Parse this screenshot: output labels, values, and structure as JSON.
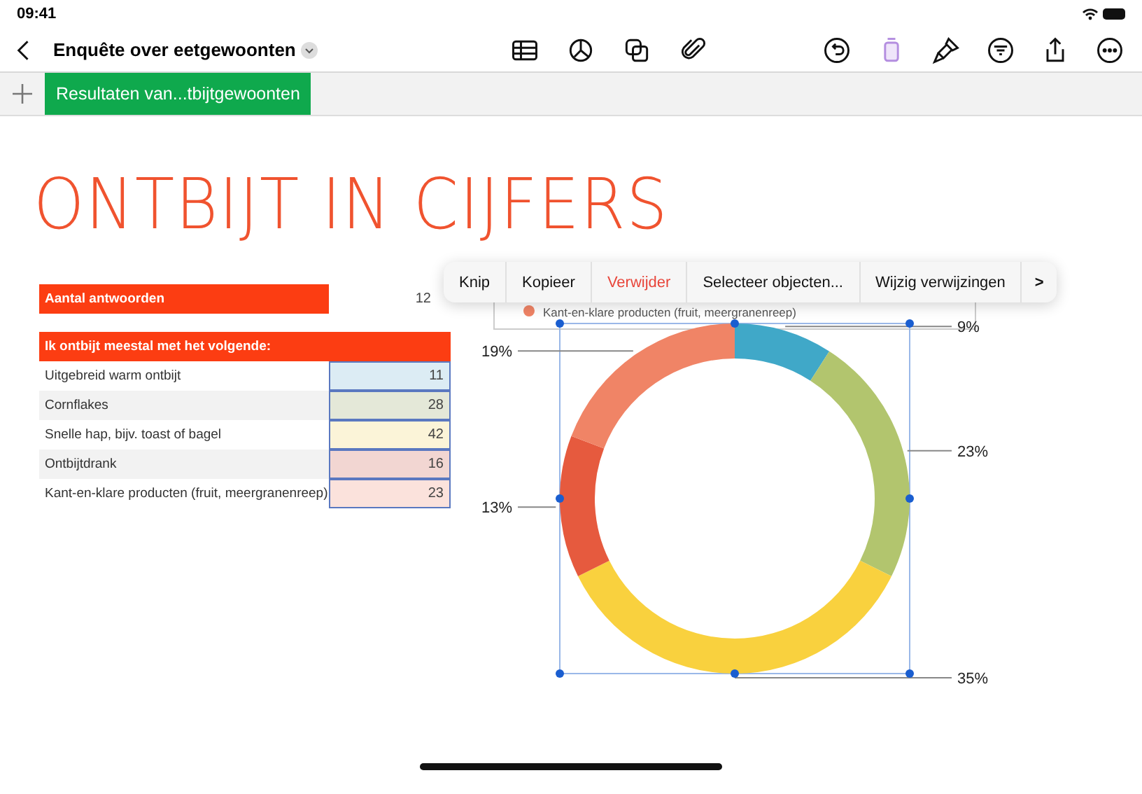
{
  "status_bar": {
    "time": "09:41"
  },
  "toolbar": {
    "title": "Enquête over eetgewoonten"
  },
  "sheet_tabs": [
    {
      "label": "Resultaten van...tbijtgewoonten",
      "selected": true
    }
  ],
  "heading": "ONTBIJT IN CIJFERS",
  "summary": {
    "label": "Aantal antwoorden",
    "value": "12"
  },
  "table": {
    "header": "Ik ontbijt meestal met het volgende:",
    "rows": [
      {
        "label": "Uitgebreid warm ontbijt",
        "value": "11",
        "color": "#dcecf4"
      },
      {
        "label": "Cornflakes",
        "value": "28",
        "color": "#e4e8d8"
      },
      {
        "label": "Snelle hap, bijv. toast of bagel",
        "value": "42",
        "color": "#fbf4d8"
      },
      {
        "label": "Ontbijtdrank",
        "value": "16",
        "color": "#f2d6d2"
      },
      {
        "label": "Kant-en-klare producten (fruit, meergranenreep)",
        "value": "23",
        "color": "#fbe2dc"
      }
    ]
  },
  "context_menu": [
    {
      "label": "Knip",
      "kind": "normal"
    },
    {
      "label": "Kopieer",
      "kind": "normal"
    },
    {
      "label": "Verwijder",
      "kind": "destructive"
    },
    {
      "label": "Selecteer objecten...",
      "kind": "normal"
    },
    {
      "label": "Wijzig verwijzingen",
      "kind": "normal"
    },
    {
      "label": ">",
      "kind": "more"
    }
  ],
  "chart": {
    "legend": "Kant-en-klare producten (fruit, meergranenreep)",
    "chart_data": {
      "type": "donut",
      "values": [
        9,
        23,
        35,
        13,
        19
      ],
      "colors": [
        "#40a8c8",
        "#b2c56e",
        "#f9d13e",
        "#e65a3e",
        "#f08466"
      ],
      "data_labels": true,
      "value_labels": [
        "9%",
        "23%",
        "35%",
        "13%",
        "19%"
      ]
    }
  }
}
